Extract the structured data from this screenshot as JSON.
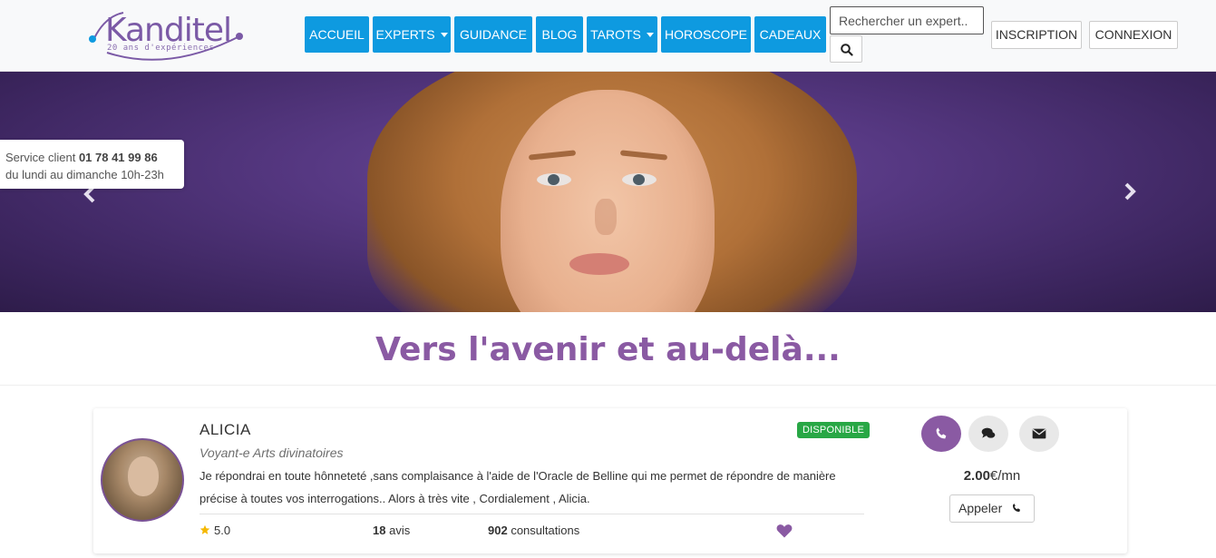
{
  "logo": {
    "name": "Kanditel",
    "tagline": "20 ans d'expériences"
  },
  "nav": {
    "items": [
      {
        "label": "ACCUEIL"
      },
      {
        "label": "EXPERTS"
      },
      {
        "label": "GUIDANCE"
      },
      {
        "label": "BLOG"
      },
      {
        "label": "TAROTS"
      },
      {
        "label": "HOROSCOPE"
      },
      {
        "label": "CADEAUX"
      }
    ]
  },
  "search": {
    "placeholder": "Rechercher un expert.."
  },
  "auth": {
    "signup_label": "INSCRIPTION",
    "login_label": "CONNEXION"
  },
  "service": {
    "label": "Service client",
    "phone": "01 78 41 99 86",
    "hours": "du lundi au dimanche 10h-23h"
  },
  "hero": {
    "prev_icon": "chevron-left-icon",
    "next_icon": "chevron-right-icon"
  },
  "tagline": "Vers l'avenir et au-delà...",
  "expert": {
    "name": "ALICIA",
    "status": "DISPONIBLE",
    "category": "Voyant-e Arts divinatoires",
    "description": "Je répondrai en toute hônneteté ,sans complaisance à l'aide de l'Oracle de Belline qui me permet de répondre de manière précise à toutes vos interrogations.. Alors à très vite , Cordialement , Alicia.",
    "rating": "5.0",
    "reviews_count": "18",
    "reviews_label": "avis",
    "consultations_count": "902",
    "consultations_label": "consultations",
    "price_value": "2.00",
    "price_unit": "€/mn",
    "call_label": "Appeler"
  },
  "colors": {
    "nav_blue": "#0e9ae0",
    "brand_purple": "#8a5aa3",
    "available_green": "#28a745"
  }
}
